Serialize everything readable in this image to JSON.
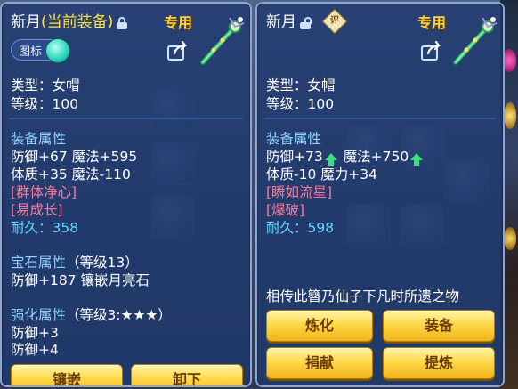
{
  "left_panel": {
    "item_name": "新月",
    "equip_status": "(当前装备)",
    "special_tag": "专用",
    "toggle_label": "图标",
    "type_line": "类型：女帽",
    "level_line": "等级：100",
    "equip_attr_header": "装备属性",
    "attr_line1": "防御+67 魔法+595",
    "attr_line2": "体质+35 魔法-110",
    "special_effect1": "[群体净心]",
    "special_effect2": "[易成长]",
    "durability_label": "耐久：",
    "durability_value": "358",
    "gem_header": "宝石属性",
    "gem_level": "（等级13）",
    "gem_line": "防御+187 镶嵌月亮石",
    "enhance_header": "强化属性",
    "enhance_level": "（等级3:★★★）",
    "enhance_line1": "防御+3",
    "enhance_line2": "防御+4",
    "btn_inlay": "镶嵌",
    "btn_unequip": "卸下"
  },
  "right_panel": {
    "item_name": "新月",
    "special_tag": "专用",
    "appraise_badge": "评",
    "type_line": "类型：女帽",
    "level_line": "等级：100",
    "equip_attr_header": "装备属性",
    "attr_line1a": "防御+73",
    "attr_line1b": "魔法+750",
    "attr_line2": "体质-10 魔力+34",
    "special_effect1": "[瞬如流星]",
    "special_effect2": "[爆破]",
    "durability_label": "耐久：",
    "durability_value": "598",
    "description": "相传此簪乃仙子下凡时所遗之物",
    "btn_refine": "炼化",
    "btn_equip": "装备",
    "btn_donate": "捐献",
    "btn_extract": "提炼"
  },
  "colors": {
    "panel_bg": "#1e386e",
    "header_blue": "#8fd3ff",
    "special_red": "#ff7a9a",
    "durability_cyan": "#63d8ff",
    "tag_gold": "#ffd23f",
    "button_gold": "#ffd84a",
    "up_arrow_green": "#3ae07a"
  },
  "icons": [
    "lock-icon",
    "unlock-icon",
    "share-icon",
    "weapon-wand-icon",
    "appraise-badge-icon",
    "up-arrow-icon",
    "toggle-knob"
  ]
}
